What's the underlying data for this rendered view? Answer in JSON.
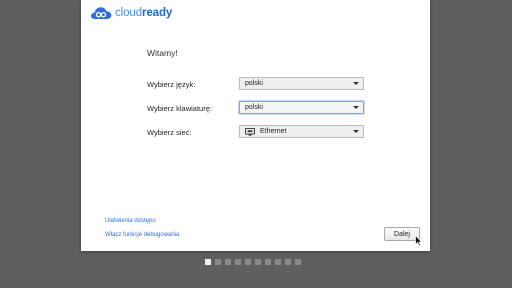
{
  "brand": {
    "part1": "cloud",
    "part2": "ready",
    "accent": "#3a7bd5"
  },
  "greeting": "Witamy!",
  "fields": {
    "language": {
      "label": "Wybierz język:",
      "value": "polski"
    },
    "keyboard": {
      "label": "Wybierz klawiaturę:",
      "value": "polski"
    },
    "network": {
      "label": "Wybierz sieć:",
      "value": "Ethernet",
      "icon": "ethernet-icon"
    }
  },
  "links": {
    "accessibility": "Ułatwienia dostępu",
    "debugging": "Włącz funkcje debugowania"
  },
  "next_label": "Dalej",
  "pager": {
    "total": 10,
    "active": 1
  }
}
